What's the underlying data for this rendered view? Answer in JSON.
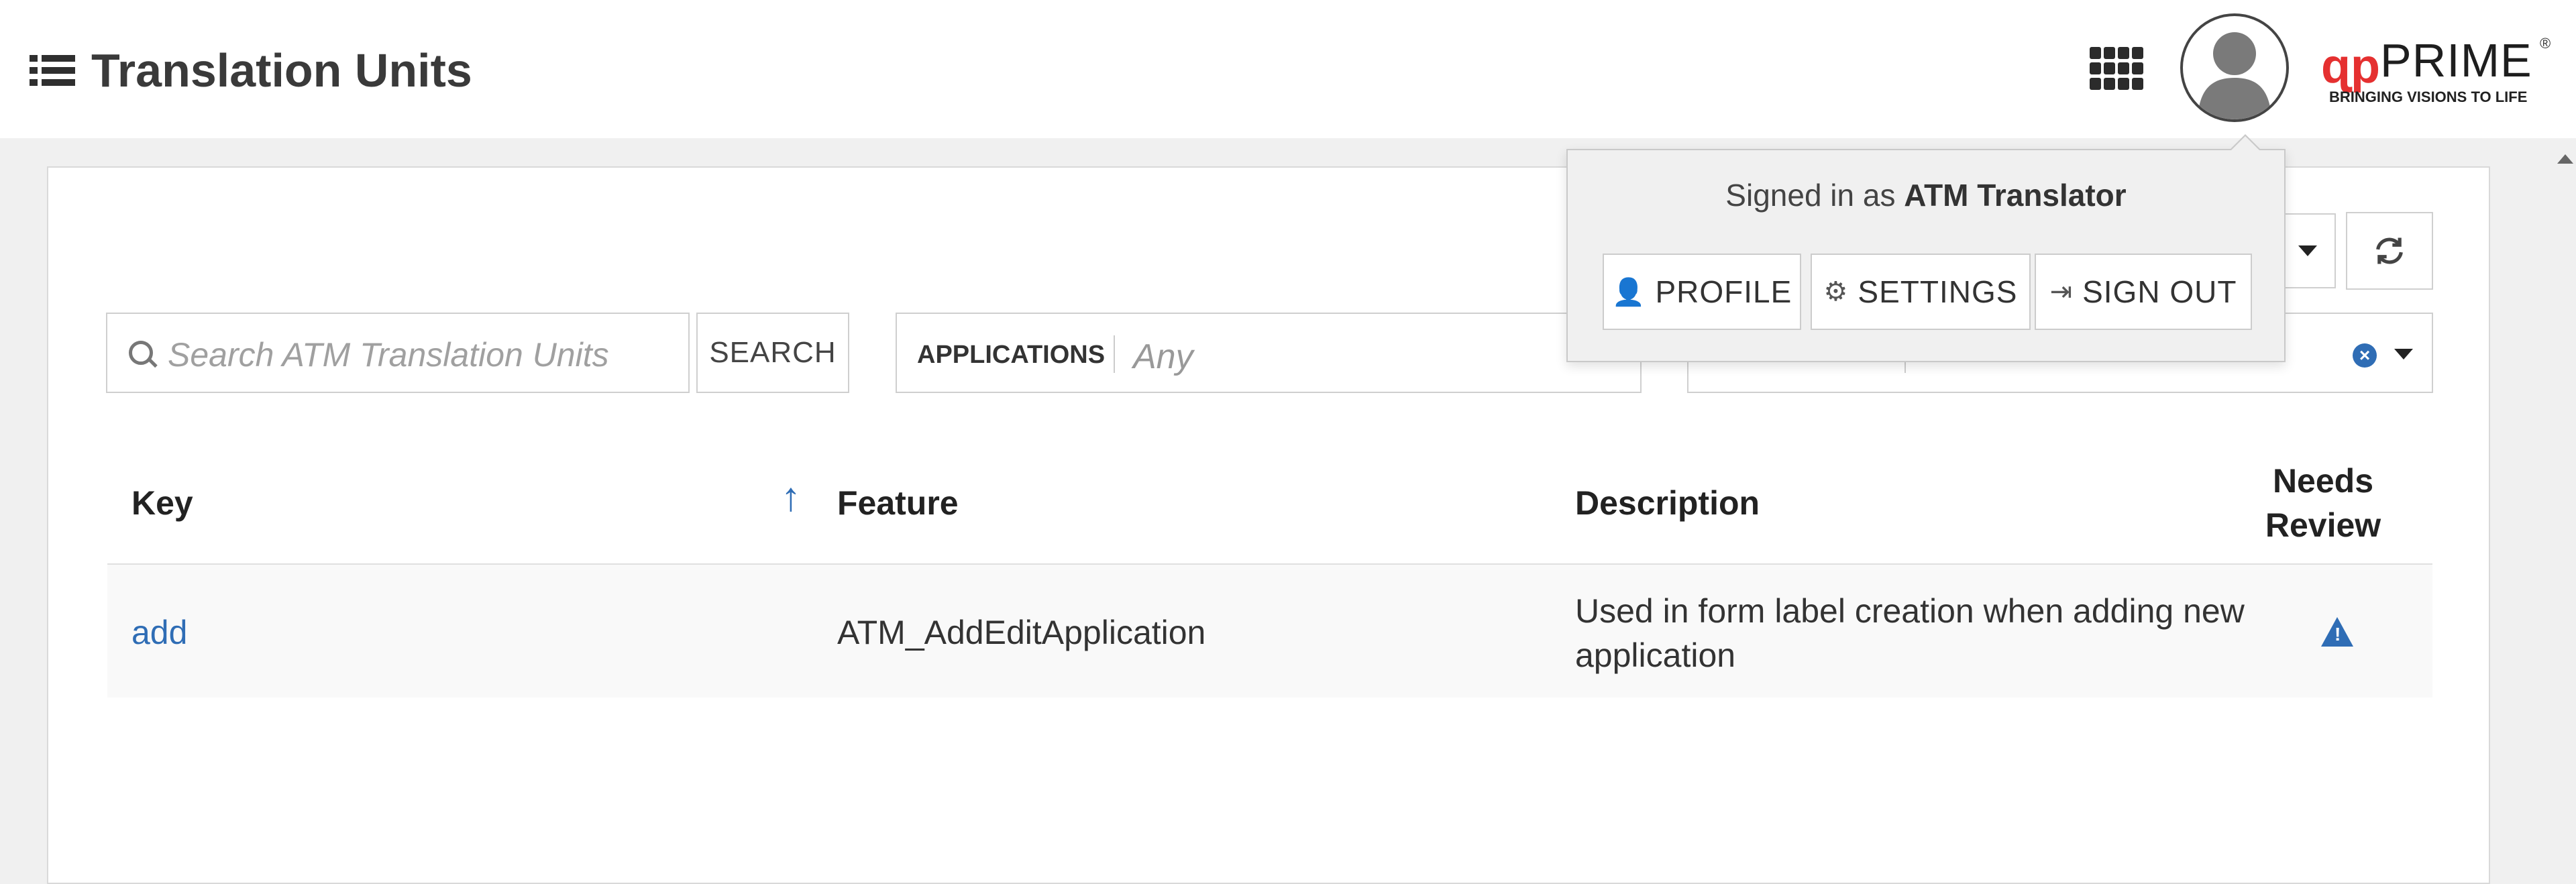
{
  "header": {
    "title": "Translation Units",
    "icons": {
      "menu": "list-icon",
      "apps": "grid-icon",
      "avatar": "user-avatar-icon"
    },
    "logo": {
      "mark": "ɋp",
      "name": "PRIME",
      "registered": "®",
      "tagline": "BRINGING VISIONS TO LIFE"
    }
  },
  "toolbar": {
    "search_placeholder": "Search ATM Translation Units",
    "search_button": "SEARCH",
    "applications_label": "APPLICATIONS",
    "applications_value": "Any",
    "refresh_icon": "refresh-icon"
  },
  "table": {
    "columns": [
      "Key",
      "Feature",
      "Description",
      "Needs Review"
    ],
    "rows": [
      {
        "key": "add",
        "feature": "ATM_AddEditApplication",
        "description": "Used in form label creation when adding new application",
        "needs_review_icon": "warning-icon"
      }
    ]
  },
  "user_menu": {
    "signed_in_prefix": "Signed in as",
    "user_name": "ATM Translator",
    "buttons": [
      "PROFILE",
      "SETTINGS",
      "SIGN OUT"
    ]
  },
  "colors": {
    "accent": "#2f6db5",
    "logo_red": "#e53030"
  }
}
